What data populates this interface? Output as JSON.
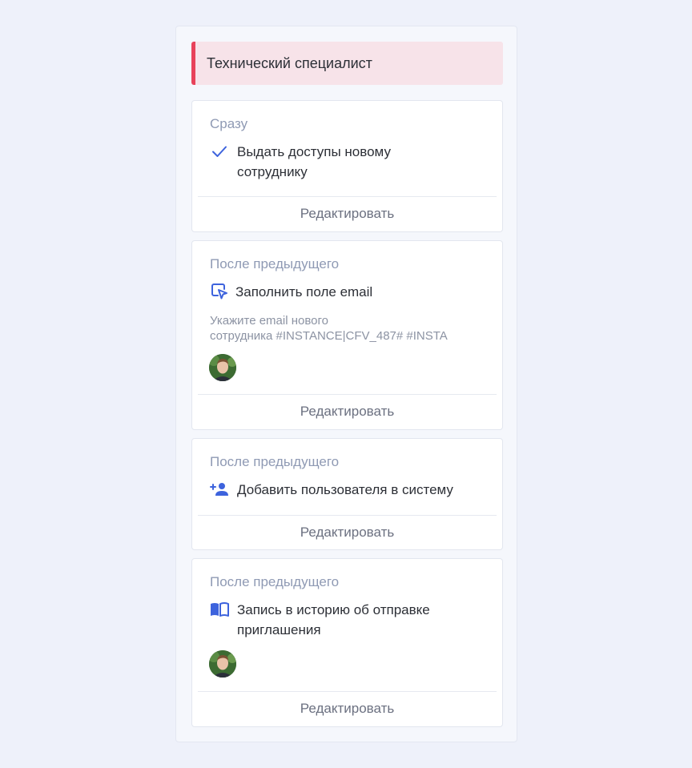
{
  "header": {
    "title": "Технический специалист"
  },
  "cards": [
    {
      "when": "Сразу",
      "icon": "check-icon",
      "action": "Выдать доступы новому сотруднику",
      "edit_label": "Редактировать"
    },
    {
      "when": "После предыдущего",
      "icon": "cursor-click-icon",
      "action": "Заполнить поле email",
      "description_lines": [
        "Укажите email нового",
        "сотрудника #INSTANCE|CFV_487# #INSTA"
      ],
      "has_avatar": true,
      "edit_label": "Редактировать"
    },
    {
      "when": "После предыдущего",
      "icon": "person-add-icon",
      "action": "Добавить пользователя в систему",
      "edit_label": "Редактировать"
    },
    {
      "when": "После предыдущего",
      "icon": "book-icon",
      "action": "Запись в историю об отправке приглашения",
      "has_avatar": true,
      "edit_label": "Редактировать"
    }
  ],
  "colors": {
    "accent": "#3d63dd",
    "header_bar": "#e8425a",
    "header_bg": "#f7e3e9",
    "muted_label": "#8f9ab4"
  }
}
